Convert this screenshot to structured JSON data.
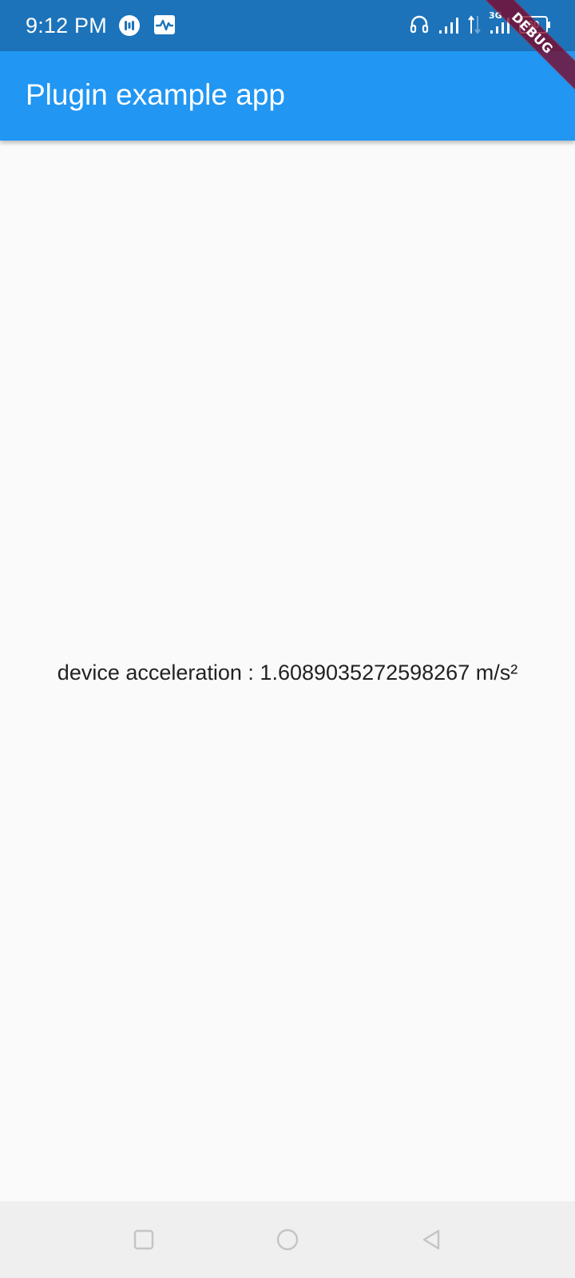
{
  "status_bar": {
    "time": "9:12 PM",
    "left_icons": [
      "media-control-icon",
      "activity-monitor-icon"
    ],
    "right_icons": [
      "headset-icon",
      "signal-icon",
      "data-transfer-icon",
      "signal-3g-icon",
      "battery-icon"
    ],
    "network_label": "3G",
    "battery_level": "60"
  },
  "app_bar": {
    "title": "Plugin example app"
  },
  "debug_banner": {
    "label": "DEBUG"
  },
  "main": {
    "acceleration_text": "device acceleration : 1.6089035272598267 m/s²"
  },
  "nav_bar": {
    "buttons": [
      "recents-square-icon",
      "home-circle-icon",
      "back-triangle-icon"
    ]
  },
  "colors": {
    "status_bar": "#1c73ba",
    "app_bar": "#2196f3",
    "background": "#fafafa",
    "nav_bar": "#efefef",
    "debug_banner": "#800020"
  }
}
